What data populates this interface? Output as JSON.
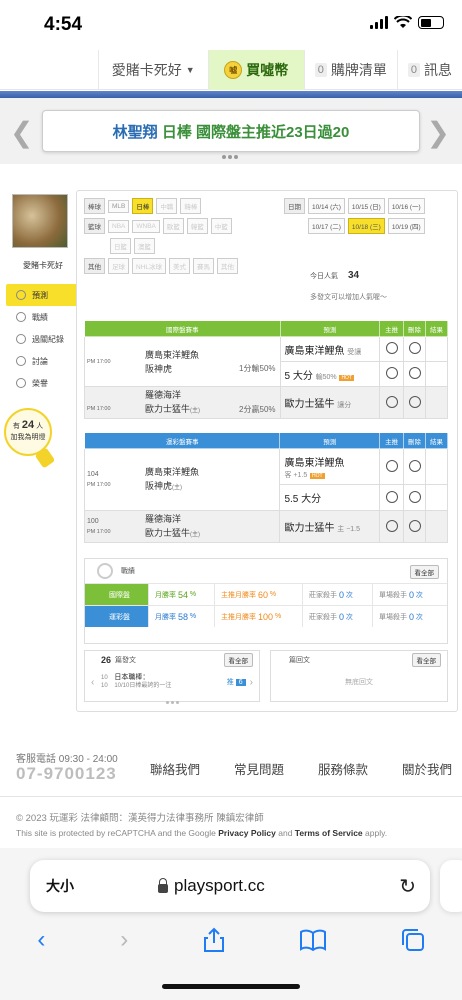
{
  "status": {
    "time": "4:54"
  },
  "nav": {
    "user": "愛賭卡死好",
    "coin": "買噓幣",
    "coin_icon_text": "噓",
    "cart_count": "0",
    "cart": "購牌清單",
    "msg_count": "0",
    "msg": "訊息"
  },
  "marquee": {
    "name": "林聖翔",
    "board": "日棒",
    "text": "國際盤主推近23日過20"
  },
  "user": {
    "name": "愛賭卡死好"
  },
  "side": {
    "items": [
      {
        "label": "預測"
      },
      {
        "label": "戰績"
      },
      {
        "label": "過關紀錄"
      },
      {
        "label": "討論"
      },
      {
        "label": "榮譽"
      }
    ],
    "bulb_pre": "有",
    "bulb_count": "24",
    "bulb_unit": "人",
    "bulb_post": "加我為明燈"
  },
  "filters": {
    "row1_label": "棒球",
    "row1": [
      "MLB",
      "日棒",
      "中職",
      "韓棒"
    ],
    "row2_label": "籃球",
    "row2": [
      "NBA",
      "WNBA",
      "歐籃",
      "韓籃",
      "中籃"
    ],
    "row3": [
      "日籃",
      "澳籃"
    ],
    "row4_label": "其他",
    "row4": [
      "足球",
      "NHL冰球",
      "美式",
      "賽馬",
      "其他"
    ]
  },
  "dates": {
    "label": "日期",
    "items": [
      "10/14 (六)",
      "10/15 (日)",
      "10/16 (一)",
      "10/17 (二)",
      "10/18 (三)",
      "10/19 (四)"
    ]
  },
  "popularity": {
    "label": "今日人氣",
    "value": "34",
    "hint": "多發文可以增加人氣喔～"
  },
  "intl": {
    "headers": [
      "國際盤賽事",
      "預測",
      "主推",
      "刪除",
      "結果"
    ],
    "games": [
      {
        "time": "PM 17:00",
        "home": "廣島東洋鯉魚",
        "away": "阪神虎",
        "away_tag": "",
        "odds1": "1分輸50%",
        "pick1": "廣島東洋鯉魚",
        "pick1_note": "受讓",
        "pick2": "5 大分",
        "pick2_note": "輸50%",
        "hot": "HOT"
      },
      {
        "time": "PM 17:00",
        "home": "羅德海洋",
        "away": "歐力士猛牛",
        "away_tag": "(主)",
        "odds1": "2分贏50%",
        "pick1": "歐力士猛牛",
        "pick1_note": "讓分"
      }
    ]
  },
  "lottery": {
    "headers": [
      "運彩盤賽事",
      "預測",
      "主推",
      "刪除",
      "結果"
    ],
    "games": [
      {
        "no": "104",
        "time": "PM 17:00",
        "home": "廣島東洋鯉魚",
        "away": "阪神虎",
        "away_tag": "(主)",
        "pick1": "廣島東洋鯉魚",
        "pick1_note": "客 +1.5",
        "pick2": "5.5 大分",
        "hot": "HOT"
      },
      {
        "no": "100",
        "time": "PM 17:00",
        "home": "羅德海洋",
        "away": "歐力士猛牛",
        "away_tag": "(主)",
        "pick1": "歐力士猛牛",
        "pick1_note": "主 −1.5"
      }
    ]
  },
  "record": {
    "title": "戰績",
    "view_all": "看全部",
    "rows": [
      {
        "tag": "國際盤",
        "monthly_label": "月勝率",
        "monthly": "54",
        "main_label": "主推月勝率",
        "main": "60",
        "pct": "%",
        "banker_label": "莊家殺手",
        "banker": "0",
        "single_label": "單場殺手",
        "single": "0",
        "unit": "次"
      },
      {
        "tag": "運彩盤",
        "monthly_label": "月勝率",
        "monthly": "58",
        "main_label": "主推月勝率",
        "main": "100",
        "pct": "%",
        "banker_label": "莊家殺手",
        "banker": "0",
        "single_label": "單場殺手",
        "single": "0",
        "unit": "次"
      }
    ]
  },
  "posts": {
    "count": "26",
    "title": "篇發文",
    "view_all": "看全部",
    "date_top": "10",
    "date_bot": "10",
    "item_title": "日本職棒：",
    "item_sub": "10/10日棒最誇的一注",
    "push_label": "推",
    "push": "6"
  },
  "replies": {
    "title": "篇回文",
    "view_all": "看全部",
    "empty": "無底回文"
  },
  "footer": {
    "service_label": "客服電話 09:30 - 24:00",
    "phone": "07-9700123",
    "links": [
      "聯絡我們",
      "常見問題",
      "服務條款",
      "關於我們"
    ],
    "copyright": "© 2023 玩運彩 法律顧問：漢英得力法律事務所 陳鎮宏律師",
    "captcha_pre": "This site is protected by reCAPTCHA and the Google ",
    "privacy": "Privacy Policy",
    "and": " and ",
    "terms": "Terms of Service",
    "captcha_post": " apply."
  },
  "browser": {
    "text_size": "大小",
    "url": "playsport.cc"
  },
  "colors": {
    "green": "#7cc03a",
    "blue": "#3b8fd6",
    "yellow": "#f7df2a",
    "accent_link": "#1f7cf5"
  }
}
